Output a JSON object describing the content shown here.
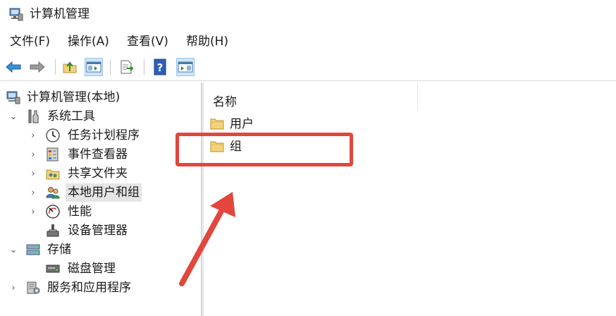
{
  "window": {
    "title": "计算机管理"
  },
  "menu": [
    {
      "label": "文件(F)"
    },
    {
      "label": "操作(A)"
    },
    {
      "label": "查看(V)"
    },
    {
      "label": "帮助(H)"
    }
  ],
  "toolbar": {
    "icons": [
      "back-arrow-icon",
      "forward-arrow-icon",
      "up-folder-icon",
      "show-hide-console-tree-icon",
      "export-list-icon",
      "help-icon",
      "show-hide-action-pane-icon"
    ]
  },
  "tree": {
    "items": [
      {
        "label": "计算机管理(本地)",
        "level": 0,
        "expander": "none",
        "icon": "computer-management-icon"
      },
      {
        "label": "系统工具",
        "level": 1,
        "expander": "expanded",
        "icon": "system-tools-icon"
      },
      {
        "label": "任务计划程序",
        "level": 2,
        "expander": "collapsed",
        "icon": "clock-icon"
      },
      {
        "label": "事件查看器",
        "level": 2,
        "expander": "collapsed",
        "icon": "event-viewer-icon"
      },
      {
        "label": "共享文件夹",
        "level": 2,
        "expander": "collapsed",
        "icon": "shared-folder-icon"
      },
      {
        "label": "本地用户和组",
        "level": 2,
        "expander": "collapsed",
        "icon": "local-users-icon",
        "selected": true
      },
      {
        "label": "性能",
        "level": 2,
        "expander": "collapsed",
        "icon": "performance-icon"
      },
      {
        "label": "设备管理器",
        "level": 2,
        "expander": "none",
        "icon": "device-manager-icon"
      },
      {
        "label": "存储",
        "level": 1,
        "expander": "expanded",
        "icon": "storage-icon"
      },
      {
        "label": "磁盘管理",
        "level": 2,
        "expander": "none",
        "icon": "disk-management-icon"
      },
      {
        "label": "服务和应用程序",
        "level": 1,
        "expander": "collapsed",
        "icon": "services-applications-icon"
      }
    ]
  },
  "list": {
    "column_header": "名称",
    "items": [
      {
        "label": "用户",
        "icon": "folder-icon"
      },
      {
        "label": "组",
        "icon": "folder-icon"
      }
    ]
  },
  "colors": {
    "annotation": "#e2463c",
    "selection": "#e5e5e5",
    "folder": "#f3d27a"
  }
}
